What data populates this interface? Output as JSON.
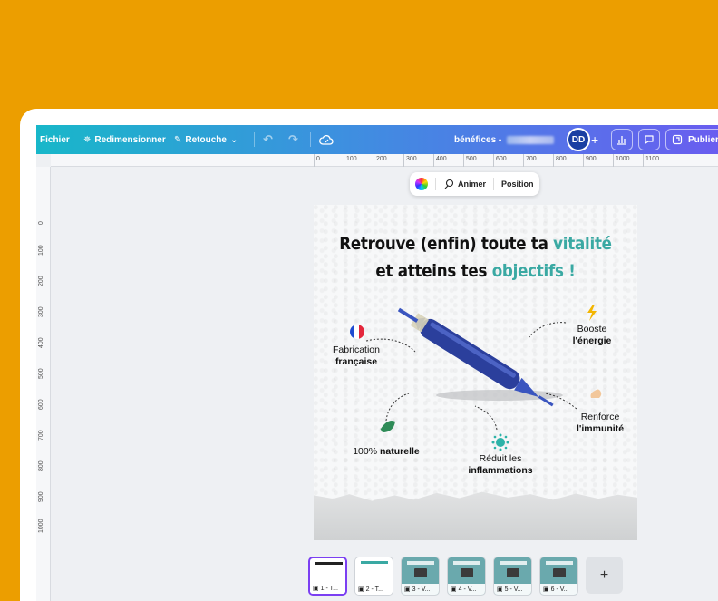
{
  "toolbar": {
    "fichier": "Fichier",
    "redimensionner": "Redimensionner",
    "retouche": "Retouche",
    "doc_title": "bénéfices -",
    "avatar_initials": "DD",
    "publier": "Publier"
  },
  "ruler": {
    "horizontal": [
      "0",
      "100",
      "200",
      "300",
      "400",
      "500",
      "600",
      "700",
      "800",
      "900",
      "1000",
      "1100"
    ],
    "vertical": [
      "0",
      "100",
      "200",
      "300",
      "400",
      "500",
      "600",
      "700",
      "800",
      "900",
      "1000"
    ]
  },
  "context_toolbar": {
    "animer": "Animer",
    "position": "Position"
  },
  "design": {
    "headline_line1_a": "Retrouve (enfin) toute ta ",
    "headline_line1_b": "vitalité",
    "headline_line2_a": "et atteins tes ",
    "headline_line2_b": "objectifs !",
    "accent_color": "#3aa9a3",
    "features": [
      {
        "line1": "Fabrication",
        "line2": "française"
      },
      {
        "line1": "Booste",
        "line2": "l'énergie"
      },
      {
        "line1": "Renforce",
        "line2": "l'immunité"
      },
      {
        "line1": "100% ",
        "line2": "naturelle"
      },
      {
        "line1": "Réduit les",
        "line2": "inflammations"
      }
    ]
  },
  "pages": [
    {
      "label": "1 - T..."
    },
    {
      "label": "2 - T..."
    },
    {
      "label": "3 - V..."
    },
    {
      "label": "4 - V..."
    },
    {
      "label": "5 - V..."
    },
    {
      "label": "6 - V..."
    }
  ],
  "add_page": "+"
}
